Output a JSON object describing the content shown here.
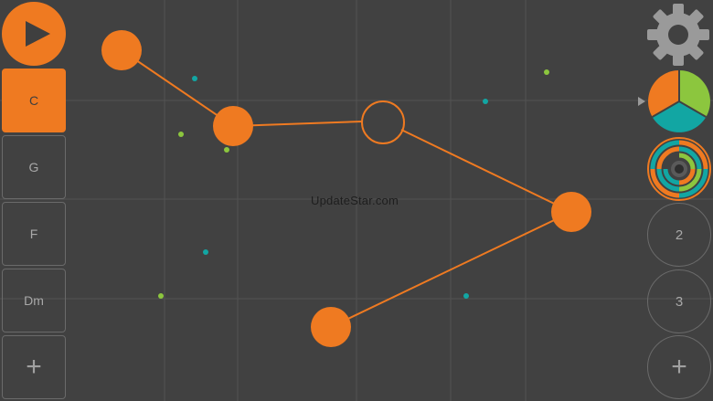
{
  "chords": [
    "C",
    "G",
    "F",
    "Dm"
  ],
  "active_chord": "C",
  "add_chord_label": "+",
  "patterns": [
    "2",
    "3"
  ],
  "add_pattern_label": "+",
  "watermark": "UpdateStar.com",
  "icons": {
    "play": "play-icon",
    "settings": "gear-icon",
    "instrument": "pie-selector-icon",
    "sequencer": "concentric-rings-icon"
  },
  "colors": {
    "background": "#414141",
    "accent": "#ef7a21",
    "green": "#8cc63e",
    "teal": "#12a6a3",
    "grid": "#4f4f4f"
  }
}
